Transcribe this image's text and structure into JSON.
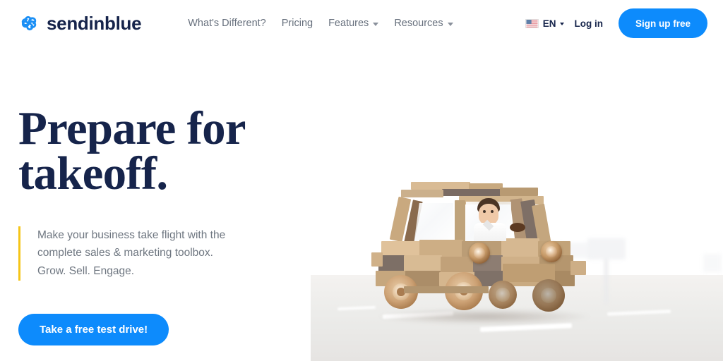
{
  "brand": {
    "name": "sendinblue",
    "logo_icon": "pinwheel-icon",
    "logo_color": "#1b8ff5"
  },
  "nav": {
    "items": [
      {
        "label": "What's Different?",
        "has_dropdown": false
      },
      {
        "label": "Pricing",
        "has_dropdown": false
      },
      {
        "label": "Features",
        "has_dropdown": true
      },
      {
        "label": "Resources",
        "has_dropdown": true
      }
    ]
  },
  "header_right": {
    "flag_icon": "us-flag-icon",
    "language": "EN",
    "language_caret_icon": "chevron-down-icon",
    "login_label": "Log in",
    "signup_label": "Sign up free"
  },
  "hero": {
    "headline_line1": "Prepare for",
    "headline_line2": "takeoff.",
    "subcopy_line1": "Make your business take flight with the",
    "subcopy_line2": "complete sales & marketing toolbox.",
    "subcopy_line3": "Grow. Sell. Engage.",
    "cta_label": "Take a free test drive!",
    "accent_bar_color": "#f5c518",
    "image_alt": "wooden-toy-car-with-boy-driver"
  },
  "colors": {
    "brand_blue": "#0d8bfc",
    "headline_navy": "#16244b",
    "nav_gray": "#67707d",
    "body_gray": "#6e7680",
    "accent_yellow": "#f5c518"
  }
}
